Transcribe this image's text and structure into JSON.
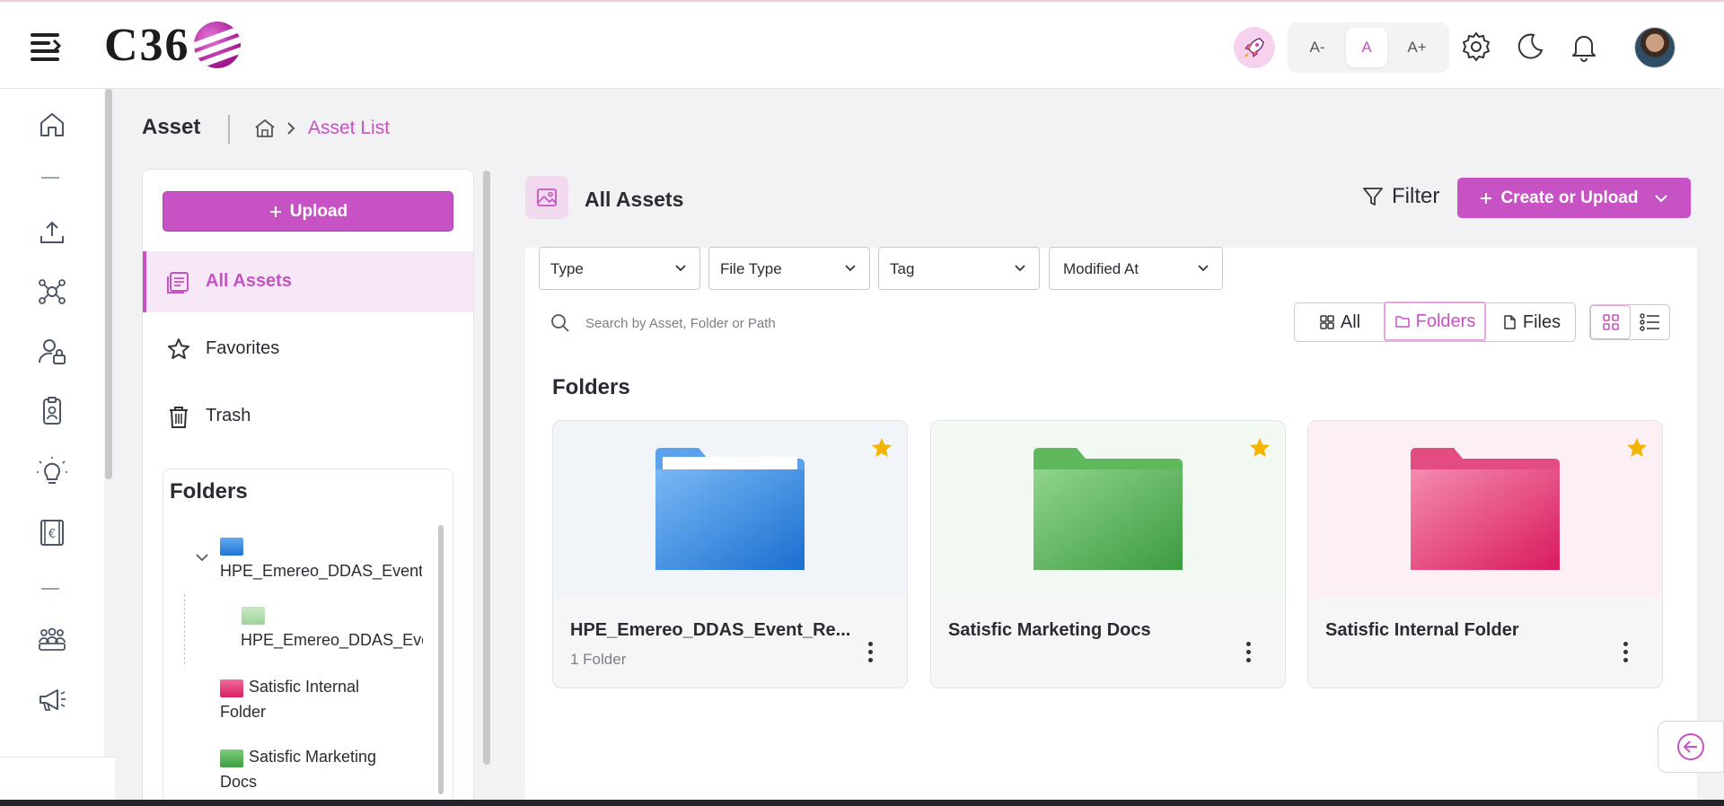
{
  "brand": {
    "logo_text": "C36"
  },
  "topbar": {
    "font_small": "A-",
    "font_normal": "A",
    "font_large": "A+",
    "icons": [
      "menu-icon",
      "rocket-icon",
      "gear-icon",
      "moon-icon",
      "bell-icon",
      "avatar"
    ]
  },
  "rail": {
    "icons": [
      "home-icon",
      "upload-icon",
      "network-icon",
      "user-lock-icon",
      "badge-icon",
      "bulb-icon",
      "currency-icon",
      "team-icon",
      "megaphone-icon"
    ]
  },
  "header": {
    "title": "Asset",
    "breadcrumb_current": "Asset List"
  },
  "left_panel": {
    "upload_label": "Upload",
    "nav": [
      {
        "label": "All Assets",
        "icon": "assets-icon",
        "active": true
      },
      {
        "label": "Favorites",
        "icon": "star-icon",
        "active": false
      },
      {
        "label": "Trash",
        "icon": "trash-icon",
        "active": false
      }
    ],
    "folders_title": "Folders",
    "tree": [
      {
        "label": "HPE_Emereo_DDAS_Event_",
        "color": "blue",
        "expanded": true
      },
      {
        "label": "HPE_Emereo_DDAS_Eve",
        "color": "lightgreen",
        "child": true
      },
      {
        "label_line1": "Satisfic Internal",
        "label_line2": "Folder",
        "color": "pink"
      },
      {
        "label_line1": "Satisfic Marketing",
        "label_line2": "Docs",
        "color": "green"
      }
    ]
  },
  "main": {
    "title": "All Assets",
    "filter_label": "Filter",
    "create_label": "Create or Upload",
    "dropdowns": [
      "Type",
      "File Type",
      "Tag",
      "Modified At"
    ],
    "search_placeholder": "Search by Asset, Folder or Path",
    "segments": {
      "all": "All",
      "folders": "Folders",
      "files": "Files",
      "active": "Folders"
    },
    "view_mode": "grid",
    "section_title": "Folders",
    "cards": [
      {
        "name": "HPE_Emereo_DDAS_Event_Re...",
        "sub": "1 Folder",
        "color": "blue",
        "starred": true
      },
      {
        "name": "Satisfic Marketing Docs",
        "sub": "",
        "color": "green",
        "starred": true
      },
      {
        "name": "Satisfic Internal Folder",
        "sub": "",
        "color": "pink",
        "starred": true
      }
    ]
  },
  "colors": {
    "accent": "#c652c4",
    "folder_blue": "#2f86dd",
    "folder_green": "#4caf50",
    "folder_pink": "#e0306e",
    "star": "#f5b400"
  }
}
